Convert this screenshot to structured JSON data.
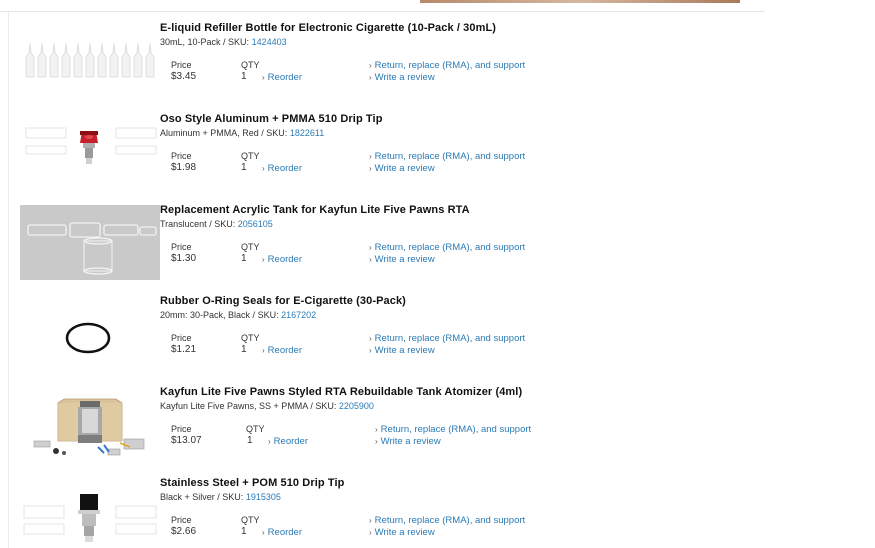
{
  "labels": {
    "price": "Price",
    "qty": "QTY",
    "sku_prefix": "SKU:",
    "reorder": "Reorder",
    "support": "Return, replace (RMA), and support",
    "review": "Write a review"
  },
  "items": [
    {
      "title": "E-liquid Refiller Bottle for Electronic Cigarette (10-Pack / 30mL)",
      "attributes": "30mL, 10-Pack /",
      "sku": "1424403",
      "price": "$3.45",
      "qty": "1",
      "thumbnail": "bottles-image"
    },
    {
      "title": "Oso Style Aluminum + PMMA 510 Drip Tip",
      "attributes": "Aluminum + PMMA, Red /",
      "sku": "1822611",
      "price": "$1.98",
      "qty": "1",
      "thumbnail": "drip-tip-red-image"
    },
    {
      "title": "Replacement Acrylic Tank for Kayfun Lite Five Pawns RTA",
      "attributes": "Translucent /",
      "sku": "2056105",
      "price": "$1.30",
      "qty": "1",
      "thumbnail": "acrylic-tank-image"
    },
    {
      "title": "Rubber O-Ring Seals for E-Cigarette (30-Pack)",
      "attributes": "20mm: 30-Pack, Black /",
      "sku": "2167202",
      "price": "$1.21",
      "qty": "1",
      "thumbnail": "o-ring-image"
    },
    {
      "title": "Kayfun Lite Five Pawns Styled RTA Rebuildable Tank Atomizer (4ml)",
      "attributes": "Kayfun Lite Five Pawns, SS + PMMA /",
      "sku": "2205900",
      "price": "$13.07",
      "qty": "1",
      "thumbnail": "atomizer-kit-image"
    },
    {
      "title": "Stainless Steel + POM 510 Drip Tip",
      "attributes": "Black + Silver /",
      "sku": "1915305",
      "price": "$2.66",
      "qty": "1",
      "thumbnail": "drip-tip-silver-image"
    }
  ]
}
